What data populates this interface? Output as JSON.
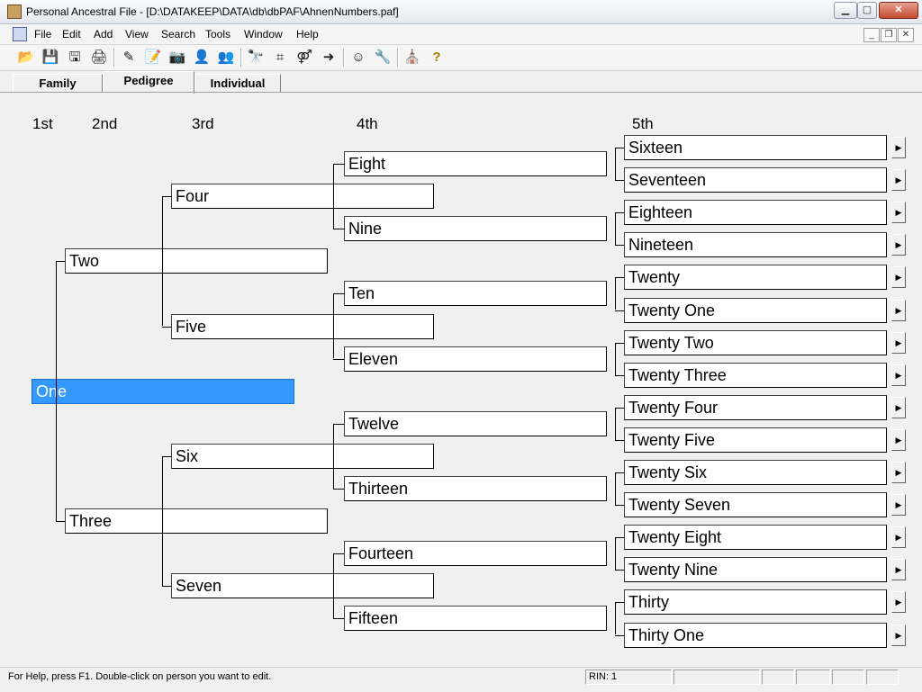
{
  "window": {
    "title": "Personal Ancestral File - [D:\\DATAKEEP\\DATA\\db\\dbPAF\\AhnenNumbers.paf]",
    "minimize": "▁",
    "maximize": "▢",
    "close": "✕"
  },
  "menu": {
    "items": [
      "File",
      "Edit",
      "Add",
      "View",
      "Search",
      "Tools",
      "Window",
      "Help"
    ]
  },
  "toolbar": {
    "icons": [
      "open-folder-icon",
      "save-icon",
      "save-as-icon",
      "print-icon",
      "edit-person-icon",
      "notes-icon",
      "camera-icon",
      "add-person-icon",
      "add-family-icon",
      "binoculars-search-icon",
      "relationship-icon",
      "family-tree-icon",
      "navigate-icon",
      "person-icon",
      "tools-icon",
      "temple-icon",
      "help-icon"
    ],
    "glyphs": [
      "📂",
      "💾",
      "🖫",
      "🖨",
      "✎",
      "📝",
      "📷",
      "👤",
      "👥",
      "🔭",
      "⌗",
      "⚤",
      "➜",
      "☺",
      "🔧",
      "⛪",
      "?"
    ]
  },
  "tabs": [
    "Family",
    "Pedigree",
    "Individual"
  ],
  "pedigree": {
    "generation_labels": [
      "1st",
      "2nd",
      "3rd",
      "4th",
      "5th"
    ],
    "gen1": [
      "One"
    ],
    "gen2": [
      "Two",
      "Three"
    ],
    "gen3": [
      "Four",
      "Five",
      "Six",
      "Seven"
    ],
    "gen4": [
      "Eight",
      "Nine",
      "Ten",
      "Eleven",
      "Twelve",
      "Thirteen",
      "Fourteen",
      "Fifteen"
    ],
    "gen5": [
      "Sixteen",
      "Seventeen",
      "Eighteen",
      "Nineteen",
      "Twenty",
      "Twenty One",
      "Twenty Two",
      "Twenty Three",
      "Twenty Four",
      "Twenty Five",
      "Twenty Six",
      "Twenty Seven",
      "Twenty Eight",
      "Twenty Nine",
      "Thirty",
      "Thirty One"
    ],
    "selected": "One",
    "more_arrow": "▶"
  },
  "status": {
    "help_text": "For Help, press F1. Double-click on person you want to edit.",
    "rin": "RIN: 1"
  }
}
